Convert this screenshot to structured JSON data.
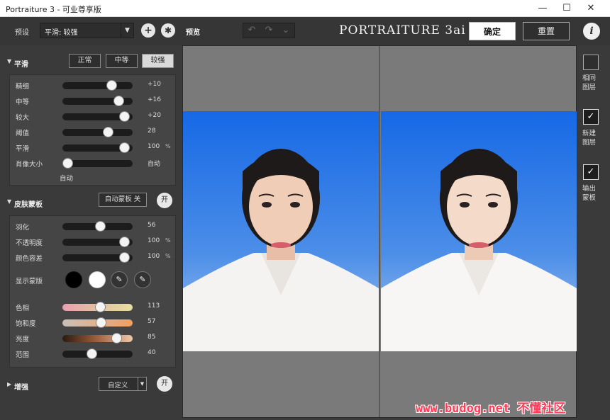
{
  "window": {
    "title": "Portraiture 3 - 可业尊享版",
    "minimize": "—",
    "maximize": "☐",
    "close": "✕"
  },
  "toolbar": {
    "preset_label": "预设",
    "preset_value": "平滑: 较强",
    "add_icon": "+",
    "gear_icon": "✱",
    "preview_label": "预览",
    "undo_icon": "↶",
    "redo_icon": "↷",
    "history_icon": "⌄",
    "brand": "PORTRAITURE 3ai",
    "ok_label": "确定",
    "reset_label": "重置",
    "info_icon": "i"
  },
  "smoothing": {
    "title": "平滑",
    "modes": [
      "正常",
      "中等",
      "较强"
    ],
    "active_mode": 2,
    "sliders": [
      {
        "label": "精细",
        "value": "+10",
        "unit": "",
        "position": 0.74
      },
      {
        "label": "中等",
        "value": "+16",
        "unit": "",
        "position": 0.86
      },
      {
        "label": "较大",
        "value": "+20",
        "unit": "",
        "position": 0.95
      },
      {
        "label": "阈值",
        "value": "28",
        "unit": "",
        "position": 0.68
      },
      {
        "label": "平滑",
        "value": "100",
        "unit": "%",
        "position": 0.95
      },
      {
        "label": "肖像大小",
        "value": "自动",
        "unit": "",
        "position": 0.0
      }
    ],
    "portrait_size_sub": "自动"
  },
  "skin_mask": {
    "title": "皮肤蒙板",
    "auto_mask_label": "自动蒙板 关",
    "on_label": "开",
    "sliders": [
      {
        "label": "羽化",
        "value": "56",
        "unit": "",
        "position": 0.55
      },
      {
        "label": "不透明度",
        "value": "100",
        "unit": "%",
        "position": 0.95
      },
      {
        "label": "颜色容差",
        "value": "100",
        "unit": "%",
        "position": 0.95
      }
    ],
    "show_mask_label": "显示蒙版",
    "swatch_colors": [
      "#000000",
      "#ffffff"
    ],
    "picker_icon": "✎",
    "picker_add_icon": "✎",
    "color_sliders": [
      {
        "label": "色相",
        "value": "113",
        "position": 0.55
      },
      {
        "label": "饱和度",
        "value": "57",
        "position": 0.56
      },
      {
        "label": "亮度",
        "value": "85",
        "position": 0.82
      },
      {
        "label": "范围",
        "value": "40",
        "position": 0.4
      }
    ]
  },
  "enhance": {
    "title": "增强",
    "select_value": "自定义",
    "on_label": "开"
  },
  "right_panel": {
    "items": [
      {
        "label_line1": "相同",
        "label_line2": "图层",
        "checked": false
      },
      {
        "label_line1": "新建",
        "label_line2": "图层",
        "checked": true
      },
      {
        "label_line1": "输出",
        "label_line2": "蒙板",
        "checked": true
      }
    ],
    "check_icon": "✓"
  },
  "watermark": "www.budog.net 不懂社区",
  "colors": {
    "accent": "#ff3b57",
    "photo_bg_top": "#1a6fe8",
    "photo_bg_bottom": "#8fb8f0"
  }
}
